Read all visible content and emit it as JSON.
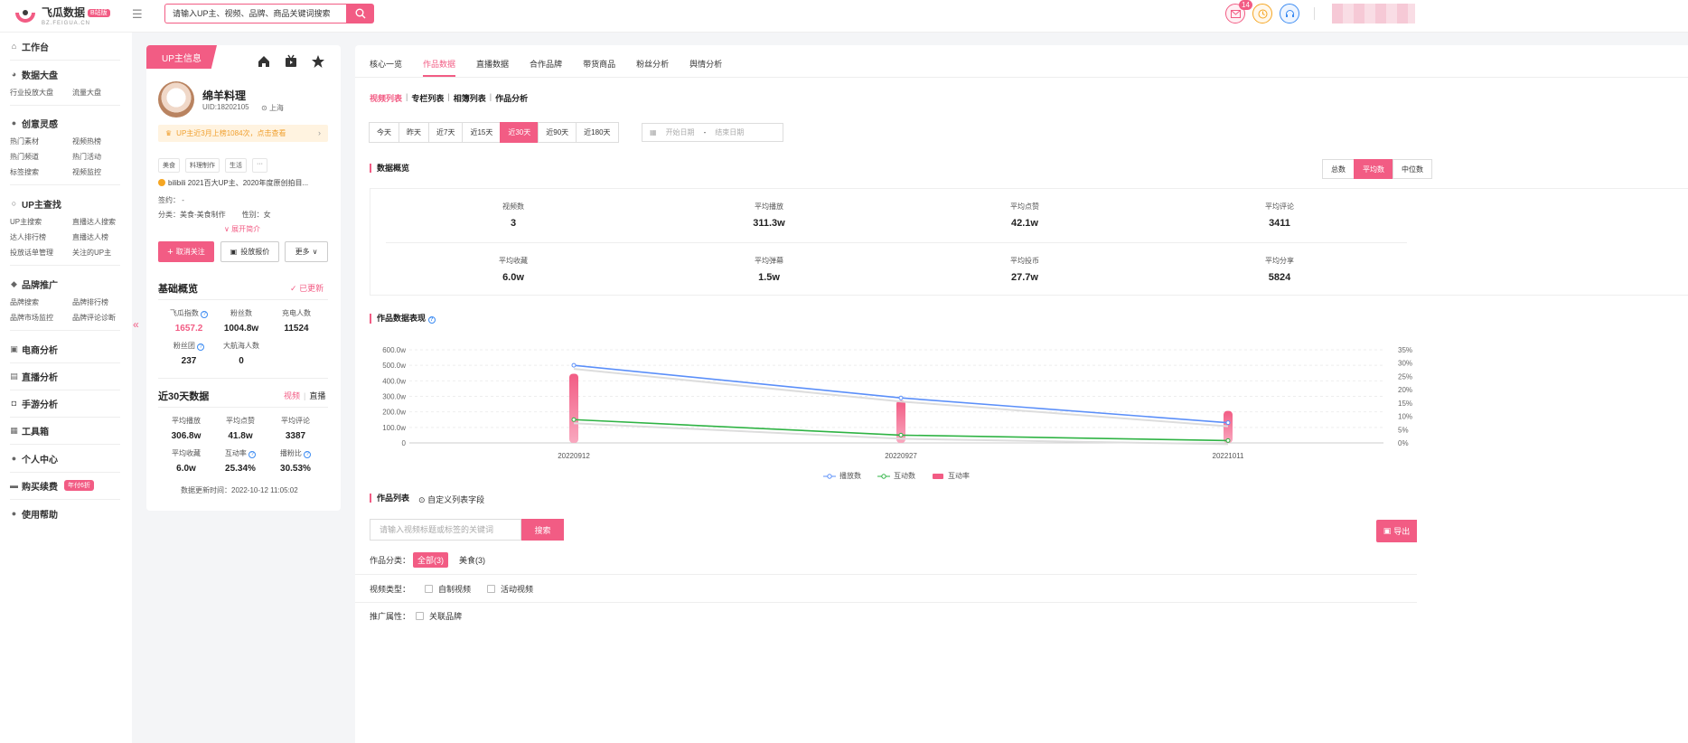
{
  "logo": {
    "name": "飞瓜数据",
    "badge": "B站版",
    "url": "BZ.FEIGUA.CN"
  },
  "search": {
    "placeholder": "请输入UP主、视频、品牌、商品关键词搜索"
  },
  "notifications": {
    "mail_count": "14"
  },
  "sidebar": {
    "workbench": "工作台",
    "data_board": {
      "title": "数据大盘",
      "items": [
        "行业投放大盘",
        "流量大盘"
      ]
    },
    "creative": {
      "title": "创意灵感",
      "items": [
        "热门素材",
        "视频热榜",
        "热门频道",
        "热门活动",
        "标签搜索",
        "视频监控"
      ]
    },
    "up_search": {
      "title": "UP主查找",
      "items": [
        "UP主搜索",
        "直播达人搜索",
        "达人排行榜",
        "直播达人榜",
        "投放话单管理",
        "关注的UP主"
      ]
    },
    "brand": {
      "title": "品牌推广",
      "items": [
        "品牌搜索",
        "品牌排行榜",
        "品牌市场监控",
        "品牌评论诊断"
      ]
    },
    "ecommerce": "电商分析",
    "live": "直播分析",
    "mobile_game": "手游分析",
    "toolbox": "工具箱",
    "personal": "个人中心",
    "purchase": "购买续费",
    "purchase_promo": "年付6折",
    "help": "使用帮助"
  },
  "up": {
    "tag": "UP主信息",
    "name": "绵羊料理",
    "uid": "UID:18202105",
    "location": "上海",
    "notice": "UP主近3月上榜1084次，点击查看",
    "tags": [
      "美食",
      "料理制作",
      "生活",
      "···"
    ],
    "desc": "bilibili 2021百大UP主、2020年度原创拍目...",
    "sign_label": "签约：",
    "sign_value": "-",
    "category_label": "分类：",
    "category_value": "美食-美食制作",
    "gender_label": "性别：",
    "gender_value": "女",
    "expand": "展开简介",
    "btn_unfollow": "取消关注",
    "btn_quote": "投放报价",
    "btn_more": "更多",
    "basic_title": "基础概览",
    "updated": "已更新",
    "basic": [
      {
        "label": "飞瓜指数",
        "value": "1657.2"
      },
      {
        "label": "粉丝数",
        "value": "1004.8w"
      },
      {
        "label": "充电人数",
        "value": "11524"
      },
      {
        "label": "粉丝团",
        "value": "237"
      },
      {
        "label": "大航海人数",
        "value": "0"
      }
    ],
    "recent_title": "近30天数据",
    "recent_switch": [
      "视频",
      "直播"
    ],
    "recent": [
      {
        "label": "平均播放",
        "value": "306.8w"
      },
      {
        "label": "平均点赞",
        "value": "41.8w"
      },
      {
        "label": "平均评论",
        "value": "3387"
      },
      {
        "label": "平均收藏",
        "value": "6.0w"
      },
      {
        "label": "互动率",
        "value": "25.34%"
      },
      {
        "label": "播粉比",
        "value": "30.53%"
      }
    ],
    "update_label": "数据更新时间：",
    "update_time": "2022-10-12 11:05:02"
  },
  "main": {
    "tabs": [
      "核心一览",
      "作品数据",
      "直播数据",
      "合作品牌",
      "带货商品",
      "粉丝分析",
      "舆情分析"
    ],
    "subtabs": [
      "视频列表",
      "专栏列表",
      "相簿列表",
      "作品分析"
    ],
    "ranges": [
      "今天",
      "昨天",
      "近7天",
      "近15天",
      "近30天",
      "近90天",
      "近180天"
    ],
    "start_date": "开始日期",
    "date_sep": "-",
    "end_date": "结束日期",
    "overview_title": "数据概览",
    "modes": [
      "总数",
      "平均数",
      "中位数"
    ],
    "overview": [
      {
        "label": "视频数",
        "value": "3"
      },
      {
        "label": "平均播放",
        "value": "311.3w"
      },
      {
        "label": "平均点赞",
        "value": "42.1w"
      },
      {
        "label": "平均评论",
        "value": "3411"
      },
      {
        "label": "平均收藏",
        "value": "6.0w"
      },
      {
        "label": "平均弹幕",
        "value": "1.5w"
      },
      {
        "label": "平均投币",
        "value": "27.7w"
      },
      {
        "label": "平均分享",
        "value": "5824"
      }
    ],
    "perf_title": "作品数据表现",
    "list_title": "作品列表",
    "custom_fields": "自定义列表字段",
    "work_search_placeholder": "请输入视频标题或标签的关键词",
    "work_search_btn": "搜索",
    "export": "导出",
    "category_label": "作品分类：",
    "category_all": "全部(3)",
    "category_food": "美食(3)",
    "type_label": "视频类型：",
    "type_self": "自制视频",
    "type_event": "活动视频",
    "promo_label": "推广属性：",
    "promo_brand": "关联品牌"
  },
  "chart_data": {
    "type": "line",
    "categories": [
      "20220912",
      "20220927",
      "20221011"
    ],
    "series": [
      {
        "name": "播放数",
        "values": [
          500,
          290,
          130
        ],
        "color": "#5b8ff9",
        "axis": "left"
      },
      {
        "name": "互动数",
        "values": [
          150,
          50,
          15
        ],
        "color": "#2fb344",
        "axis": "left"
      },
      {
        "name": "互动率",
        "values": [
          26,
          16,
          12
        ],
        "color": "#f25c84",
        "axis": "right",
        "type": "bar"
      }
    ],
    "y_ticks": [
      "0",
      "100.0w",
      "200.0w",
      "300.0w",
      "400.0w",
      "500.0w",
      "600.0w"
    ],
    "y2_ticks": [
      "0%",
      "5%",
      "10%",
      "15%",
      "20%",
      "25%",
      "30%",
      "35%"
    ],
    "ylim": [
      0,
      600
    ],
    "y2lim": [
      0,
      35
    ],
    "grid": true,
    "legend": "bottom"
  }
}
